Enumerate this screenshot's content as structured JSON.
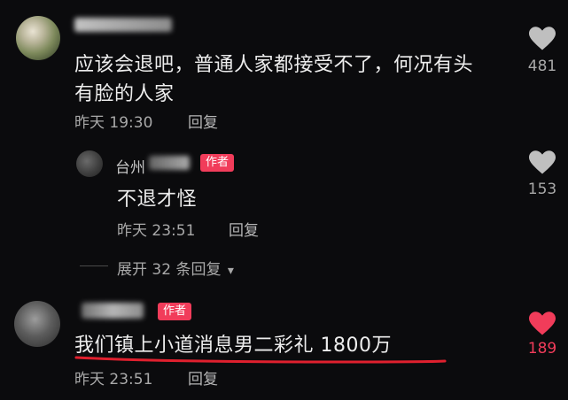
{
  "comments": [
    {
      "text_line1": "应该会退吧，普通人家都接受不了，何况有头",
      "text_line2": "有脸的人家",
      "time": "昨天 19:30",
      "reply_label": "回复",
      "likes": "481"
    }
  ],
  "reply": {
    "name_visible": "台州",
    "author_badge": "作者",
    "text": "不退才怪",
    "time": "昨天 23:51",
    "reply_label": "回复",
    "likes": "153"
  },
  "expand": {
    "label": "展开 32 条回复",
    "arrow": "▾"
  },
  "author_comment": {
    "author_badge": "作者",
    "text": "我们镇上小道消息男二彩礼 1800万",
    "time": "昨天 23:51",
    "reply_label": "回复",
    "likes": "189"
  },
  "colors": {
    "background": "#0b0b0d",
    "accent_red": "#f13c5a",
    "heart_gray": "#bfbfbf"
  },
  "icons": {
    "like": "heart-icon",
    "like_active": "heart-filled-icon",
    "expand": "chevron-down-icon"
  }
}
